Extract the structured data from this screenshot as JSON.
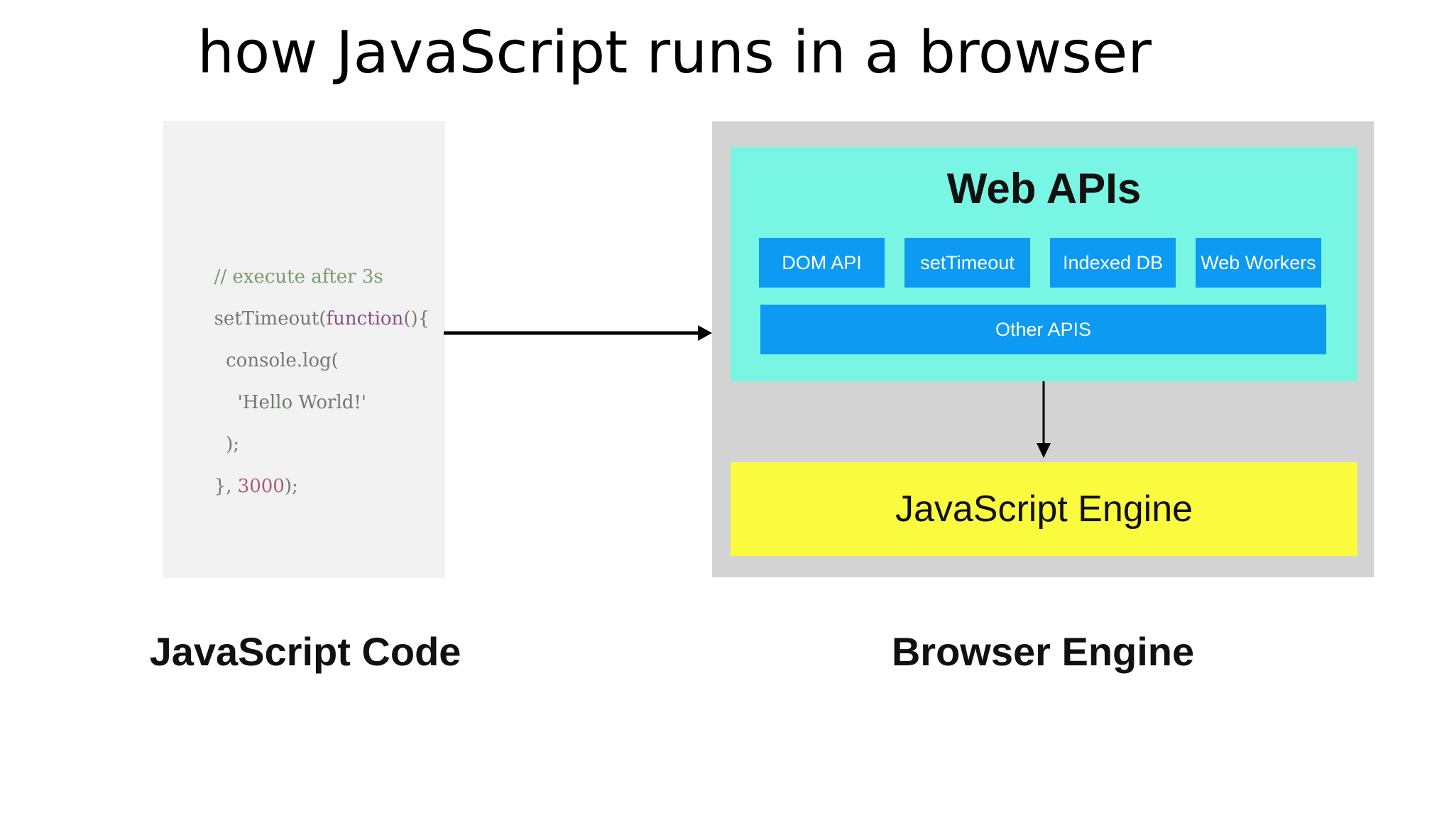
{
  "title": "how JavaScript runs in a browser",
  "code_panel": {
    "lines": [
      {
        "parts": [
          {
            "text": "// execute after 3s",
            "kind": "comment"
          }
        ]
      },
      {
        "parts": [
          {
            "text": "setTimeout(",
            "kind": "plain"
          },
          {
            "text": "function",
            "kind": "kw"
          },
          {
            "text": "(){",
            "kind": "plain"
          }
        ]
      },
      {
        "parts": [
          {
            "text": "  console.log(",
            "kind": "plain"
          }
        ]
      },
      {
        "parts": [
          {
            "text": "    'Hello World!'",
            "kind": "str"
          }
        ]
      },
      {
        "parts": [
          {
            "text": "  );",
            "kind": "plain"
          }
        ]
      },
      {
        "parts": [
          {
            "text": "}, ",
            "kind": "plain"
          },
          {
            "text": "3000",
            "kind": "num"
          },
          {
            "text": ");",
            "kind": "plain"
          }
        ]
      }
    ],
    "caption": "JavaScript Code"
  },
  "browser_engine": {
    "web_apis": {
      "title": "Web APIs",
      "items": [
        "DOM API",
        "setTimeout",
        "Indexed DB",
        "Web Workers"
      ],
      "other": "Other APIS"
    },
    "js_engine": "JavaScript Engine",
    "caption": "Browser Engine"
  },
  "colors": {
    "web_apis_bg": "#78f5e3",
    "api_button": "#0d9af2",
    "js_engine_bg": "#fafa3f",
    "engine_panel_bg": "#d3d3d3",
    "code_panel_bg": "#f2f2f2"
  }
}
